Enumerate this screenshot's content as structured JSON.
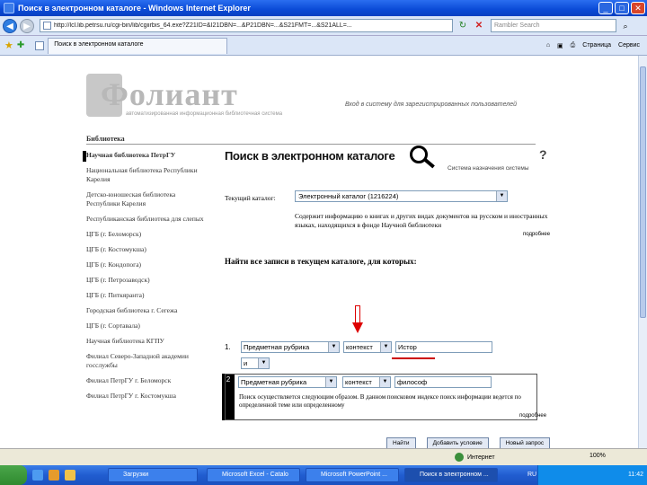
{
  "window": {
    "title": "Поиск в электронном каталоге - Windows Internet Explorer"
  },
  "address": {
    "url": "http://lcl.lib.petrsu.ru/cgi-bin/lib/cgiirbis_64.exe?Z21ID=&I21DBN=...&P21DBN=...&S21FMT=...&S21ALL=...",
    "search_placeholder": "Rambler Search"
  },
  "tabbar": {
    "tab_title": "Поиск в электронном каталоге",
    "page_menu": "Страница",
    "tools_menu": "Сервис"
  },
  "page": {
    "logo_text": "Фолиант",
    "logo_tagline": "автоматизированная информационная библиотечная система",
    "login_link": "Вход в систему для зарегистрированных пользователей",
    "section_heading": "Библиотека",
    "sidebar": [
      "Научная библиотека ПетрГУ",
      "Национальная библиотека Республики Карелия",
      "Детско-юношеская библиотека Республики Карелия",
      "Республиканская библиотека для слепых",
      "ЦГБ (г. Беломорск)",
      "ЦГБ (г. Костомукша)",
      "ЦГБ (г. Кондопога)",
      "ЦГБ (г. Петрозаводск)",
      "ЦГБ (г. Питкяранта)",
      "Городская библиотека г. Сегежа",
      "ЦГБ (г. Сортавала)",
      "Научная библиотека КГПУ",
      "Филиал Северо-Западной академии госслужбы",
      "Филиал ПетрГУ г. Беломорск",
      "Филиал ПетрГУ г. Костомукша"
    ],
    "title": "Поиск в электронном каталоге",
    "help": "?",
    "system_caption": "Система назначения системы",
    "current_catalog_label": "Текущий каталог:",
    "current_catalog_value": "Электронный каталог (1216224)",
    "catalog_desc": "Содержит информацию о книгах и других видах документов на русском и иностранных языках, находящихся в фонде Научной библиотеки",
    "more": "подробнее",
    "find_heading": "Найти все записи в текущем каталоге, для которых:",
    "row1": {
      "num": "1.",
      "field": "Предметная рубрика",
      "mode": "контекст",
      "value": "Истор",
      "logic": "и"
    },
    "row2": {
      "num": "2",
      "field": "Предметная рубрика",
      "mode": "контекст",
      "value": "философ",
      "note": "Поиск осуществляется следующим образом. В данном поисковом индексе поиск информации ведется по определенной теме или определенному"
    },
    "buttons": {
      "find": "Найти",
      "add": "Добавить условие",
      "new": "Новый запрос"
    }
  },
  "status": {
    "zone": "Интернет",
    "zoom": "100%"
  },
  "taskbar": {
    "tasks": [
      "Загрузки",
      "Microsoft Excel - Catalo",
      "Microsoft PowerPoint ...",
      "Поиск в электронном ..."
    ],
    "lang": "RU",
    "clock": "11:42"
  }
}
